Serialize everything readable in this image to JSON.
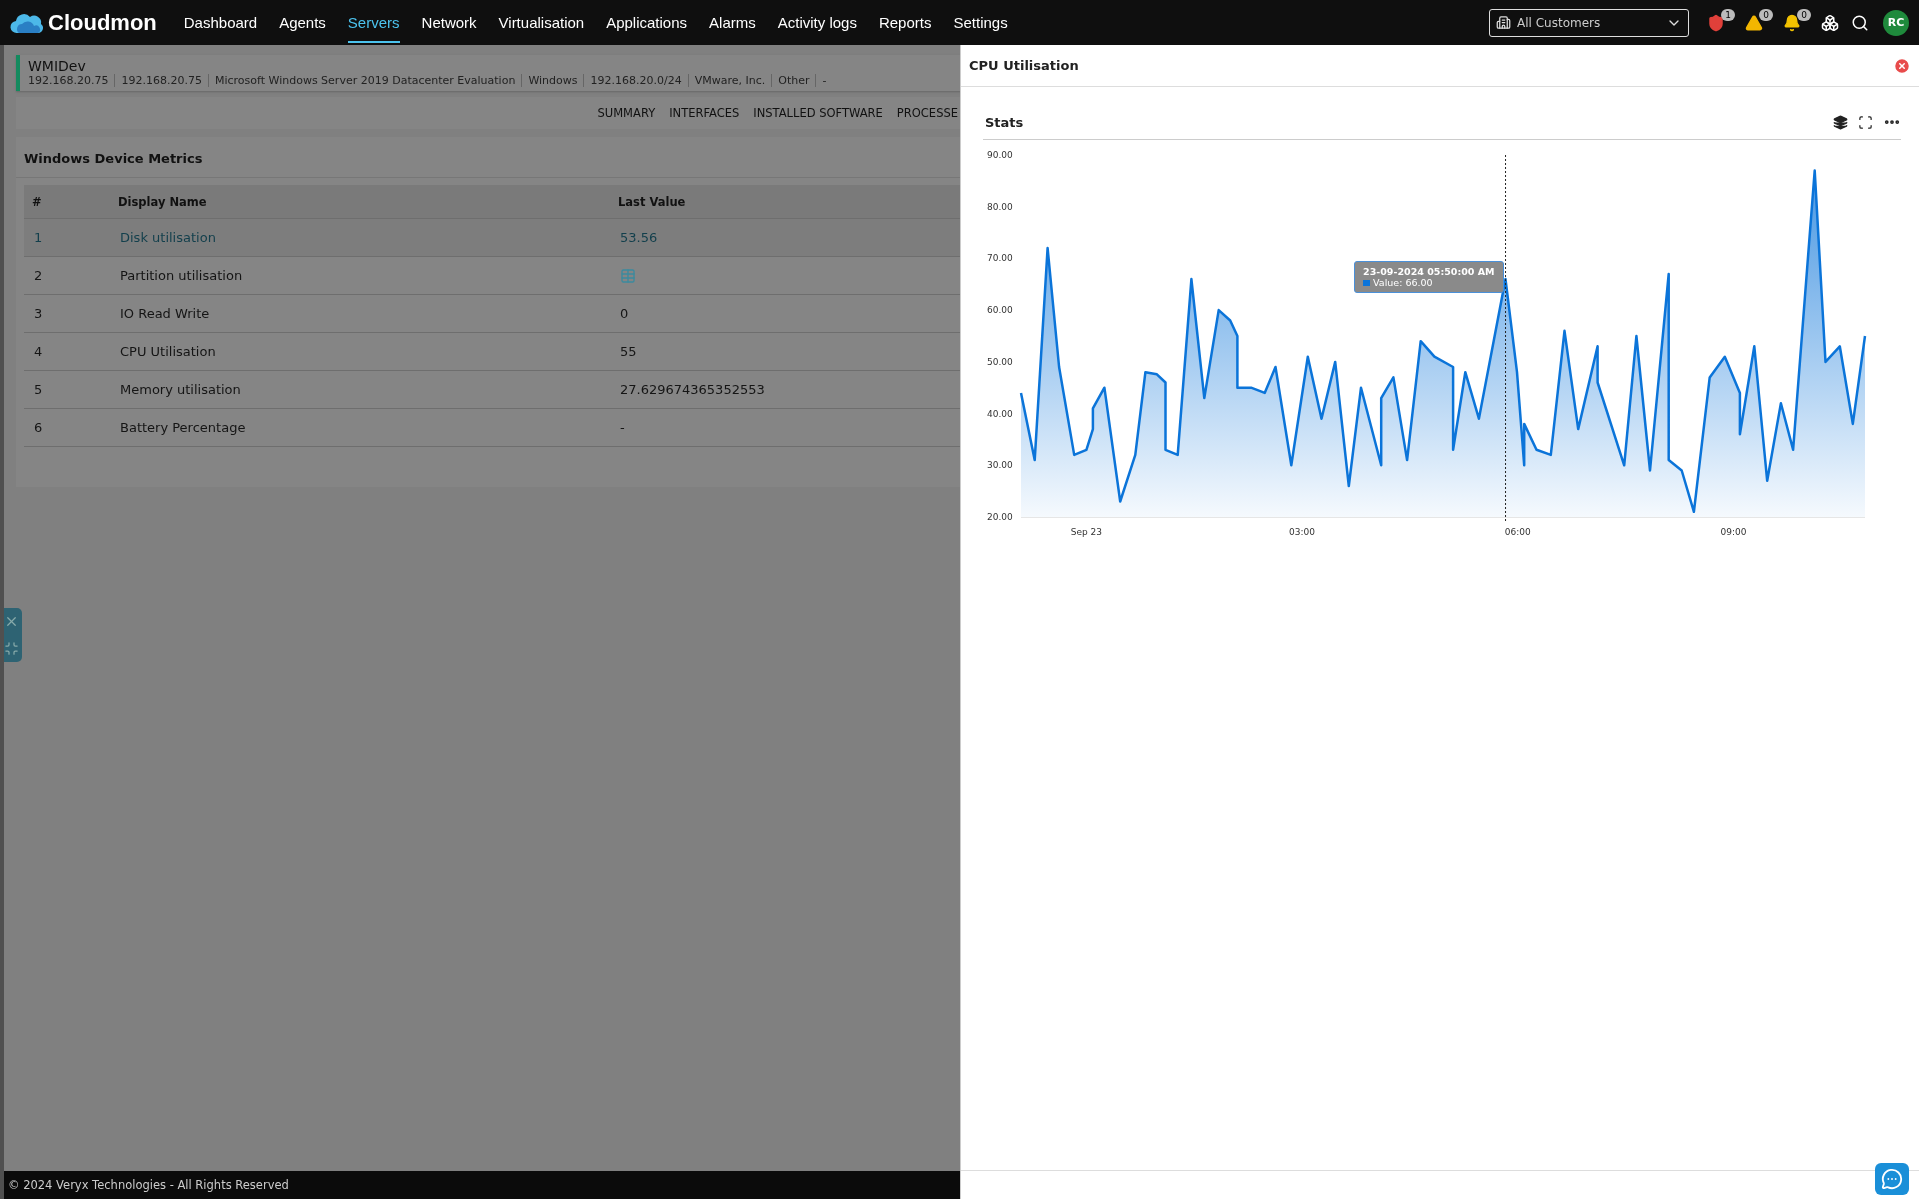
{
  "nav": {
    "brand": "Cloudmon",
    "items": [
      {
        "label": "Dashboard",
        "selected": false
      },
      {
        "label": "Agents",
        "selected": false
      },
      {
        "label": "Servers",
        "selected": true
      },
      {
        "label": "Network",
        "selected": false
      },
      {
        "label": "Virtualisation",
        "selected": false
      },
      {
        "label": "Applications",
        "selected": false
      },
      {
        "label": "Alarms",
        "selected": false
      },
      {
        "label": "Activity logs",
        "selected": false
      },
      {
        "label": "Reports",
        "selected": false
      },
      {
        "label": "Settings",
        "selected": false
      }
    ],
    "customer_select": {
      "value": "All Customers"
    },
    "alerts": [
      {
        "kind": "security",
        "count": "1"
      },
      {
        "kind": "warning",
        "count": "0"
      },
      {
        "kind": "notification",
        "count": "0"
      }
    ],
    "avatar": "RC"
  },
  "device": {
    "name": "WMIDev",
    "details": [
      "192.168.20.75",
      "192.168.20.75",
      "Microsoft Windows Server 2019 Datacenter Evaluation",
      "Windows",
      "192.168.20.0/24",
      "VMware, Inc.",
      "Other",
      "-"
    ]
  },
  "tabs": [
    "SUMMARY",
    "INTERFACES",
    "INSTALLED SOFTWARE",
    "PROCESSE"
  ],
  "metrics": {
    "title": "Windows Device Metrics",
    "columns": [
      "#",
      "Display Name",
      "Last Value"
    ],
    "rows": [
      {
        "index": "1",
        "name": "Disk utilisation",
        "kind": "text",
        "value": "53.56",
        "selected": true
      },
      {
        "index": "2",
        "name": "Partition utilisation",
        "kind": "table-icon",
        "selected": false
      },
      {
        "index": "3",
        "name": "IO Read Write",
        "kind": "text",
        "value": "0",
        "selected": false
      },
      {
        "index": "4",
        "name": "CPU Utilisation",
        "kind": "text",
        "value": "55",
        "selected": false
      },
      {
        "index": "5",
        "name": "Memory utilisation",
        "kind": "text",
        "value": "27.629674365352553",
        "selected": false
      },
      {
        "index": "6",
        "name": "Battery Percentage",
        "kind": "text",
        "value": "-",
        "selected": false
      }
    ]
  },
  "footer": "© 2024 Veryx Technologies - All Rights Reserved",
  "panel": {
    "title": "CPU Utilisation",
    "card": {
      "title": "Stats",
      "chart_data": {
        "type": "area",
        "x": [
          -0.91,
          -0.72,
          -0.54,
          -0.38,
          -0.17,
          0,
          0.09,
          0.09,
          0.25,
          0.47,
          0.68,
          0.82,
          0.98,
          1.1,
          1.1,
          1.27,
          1.46,
          1.64,
          1.84,
          2.0,
          2.1,
          2.1,
          2.29,
          2.48,
          2.63,
          2.85,
          3.08,
          3.27,
          3.46,
          3.65,
          3.82,
          4.1,
          4.1,
          4.27,
          4.46,
          4.65,
          4.84,
          5.1,
          5.1,
          5.27,
          5.46,
          5.83,
          5.99,
          6.09,
          6.09,
          6.26,
          6.46,
          6.65,
          6.84,
          7.11,
          7.11,
          7.48,
          7.65,
          7.84,
          8.1,
          8.1,
          8.28,
          8.45,
          8.67,
          8.88,
          9.09,
          9.09,
          9.29,
          9.47,
          9.66,
          9.83,
          10.13,
          10.28,
          10.48,
          10.66,
          10.83
        ],
        "series": [
          {
            "color": "#0b74d9",
            "values": [
              44,
              31,
              72,
              49,
              32,
              33,
              37,
              41,
              45,
              23,
              32,
              48,
              47.6,
              46,
              33,
              32,
              66,
              43,
              60,
              58,
              55,
              45,
              45,
              44,
              49,
              30,
              51,
              39,
              50,
              26,
              45,
              30,
              43,
              47,
              31,
              54,
              51,
              49,
              33,
              48,
              39,
              66,
              48,
              30,
              38,
              33,
              32,
              56,
              37,
              53,
              46,
              30,
              55,
              29,
              67,
              31,
              29,
              21,
              47,
              51,
              44,
              36,
              53,
              27,
              42,
              33,
              87,
              50,
              53,
              38,
              55
            ]
          }
        ],
        "xlim": [
          -0.91,
          10.83
        ],
        "ylim": [
          20,
          90
        ],
        "xticks": [
          {
            "value": 0,
            "label": "Sep 23"
          },
          {
            "value": 3,
            "label": "03:00"
          },
          {
            "value": 6,
            "label": "06:00"
          },
          {
            "value": 9,
            "label": "09:00"
          }
        ],
        "yticks": [
          {
            "value": 20,
            "label": "20.00"
          },
          {
            "value": 30,
            "label": "30.00"
          },
          {
            "value": 40,
            "label": "40.00"
          },
          {
            "value": 50,
            "label": "50.00"
          },
          {
            "value": 60,
            "label": "60.00"
          },
          {
            "value": 70,
            "label": "70.00"
          },
          {
            "value": 80,
            "label": "80.00"
          },
          {
            "value": 90,
            "label": "90.00"
          }
        ],
        "ref_lines": [
          {
            "axis": "x",
            "value": 5.83
          }
        ]
      },
      "tooltip": {
        "title": "23-09-2024 05:50:00 AM",
        "text": "Value: 66.00"
      }
    }
  }
}
